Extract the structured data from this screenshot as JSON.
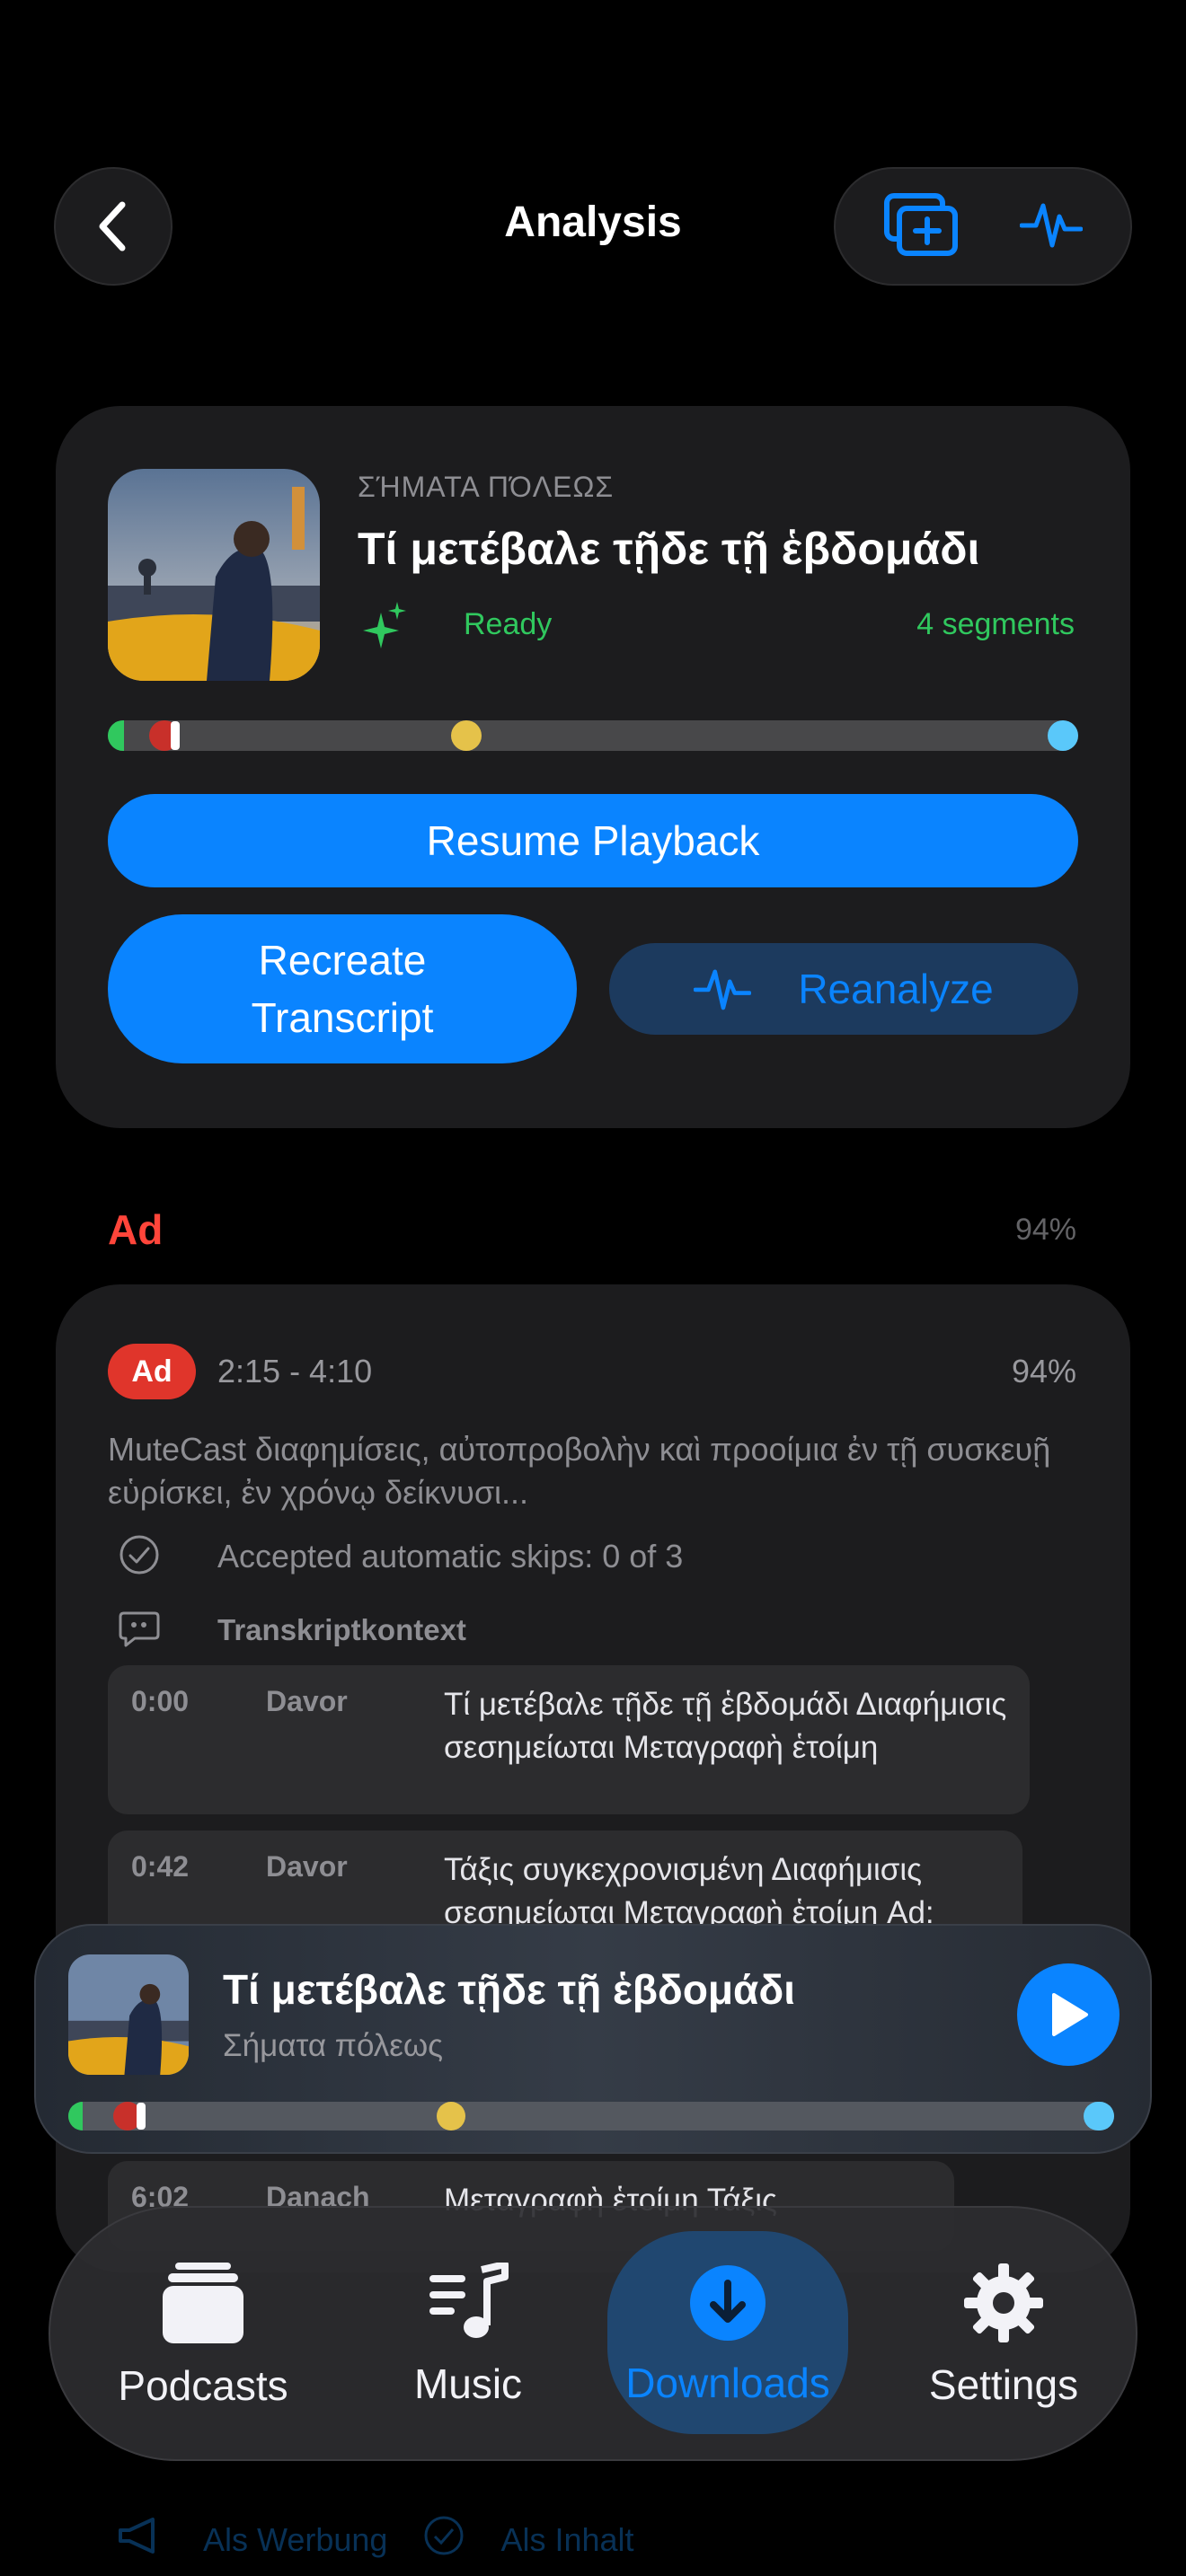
{
  "header": {
    "title": "Analysis",
    "back_icon": "chevron-left-icon",
    "actions": [
      "add-to-queue-icon",
      "waveform-icon"
    ]
  },
  "episode": {
    "podcast": "ΣΉΜΑΤΑ ΠΌΛΕΩΣ",
    "title": "Τί μετέβαλε τῇδε τῇ ἑβδομάδι",
    "status": "Ready",
    "segments": "4 segments",
    "buttons": {
      "resume": "Resume Playback",
      "recreate_line1": "Recreate",
      "recreate_line2": "Transcript",
      "reanalyze": "Reanalyze"
    }
  },
  "ad_section": {
    "heading": "Ad",
    "percent": "94%",
    "card": {
      "badge": "Ad",
      "time_range": "2:15 - 4:10",
      "percent": "94%",
      "description": "MuteCast διαφημίσεις, αὐτοπροβολὴν καὶ προοίμια ἐν τῇ συσκευῇ εὑρίσκει, ἐν χρόνῳ δείκνυσι...",
      "accepted": "Accepted automatic skips: 0 of 3",
      "context_label": "Transkriptkontext",
      "transcript": [
        {
          "time": "0:00",
          "speaker": "Davor",
          "text": "Τί μετέβαλε τῇδε τῇ ἑβδομάδι Διαφήμισις σεσημείωται Μεταγραφὴ ἑτοίμη"
        },
        {
          "time": "0:42",
          "speaker": "Davor",
          "text": "Τάξις συγκεχρονισμένη Διαφήμισις σεσημείωται Μεταγραφὴ ἑτοίμη Ad:"
        },
        {
          "time": "6:02",
          "speaker": "Danach",
          "text": "Μεταγραφὴ ἑτοίμη Τάξις"
        }
      ],
      "actions": {
        "mark_ad": "Als Werbung",
        "mark_content": "Als Inhalt"
      }
    }
  },
  "mini_player": {
    "title": "Τί μετέβαλε τῇδε τῇ ἑβδομάδι",
    "subtitle": "Σήματα πόλεως",
    "play_icon": "play-icon"
  },
  "tabbar": {
    "active": "Downloads",
    "tabs": [
      {
        "label": "Podcasts",
        "icon": "podcasts-stack-icon"
      },
      {
        "label": "Music",
        "icon": "music-note-icon"
      },
      {
        "label": "Downloads",
        "icon": "download-icon"
      },
      {
        "label": "Settings",
        "icon": "gear-icon"
      }
    ]
  },
  "colors": {
    "accent": "#0a84ff",
    "ready": "#30c85e",
    "ad": "#ff453a",
    "marker_green": "#30c85e",
    "marker_red": "#c8302a",
    "marker_yellow": "#e5c24a",
    "marker_blue": "#5ac8fa"
  }
}
